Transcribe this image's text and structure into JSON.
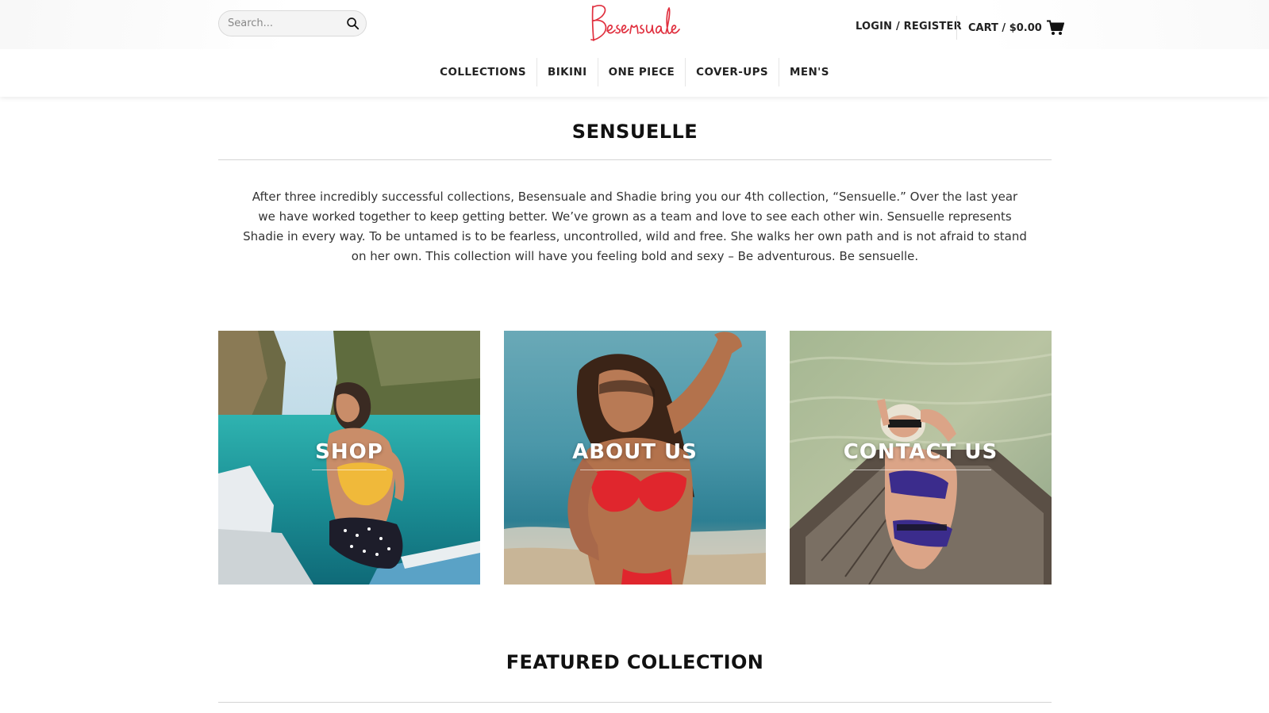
{
  "brand": {
    "logo_text": "Besensuale",
    "accent_color": "#e0303f"
  },
  "header": {
    "search": {
      "placeholder": "Search...",
      "icon": "search-icon"
    },
    "account_label": "LOGIN / REGISTER",
    "cart": {
      "label": "CART / $0.00",
      "icon": "cart-icon"
    }
  },
  "nav": {
    "items": [
      {
        "label": "COLLECTIONS"
      },
      {
        "label": "BIKINI"
      },
      {
        "label": "ONE PIECE"
      },
      {
        "label": "COVER-UPS"
      },
      {
        "label": "MEN'S"
      }
    ]
  },
  "main": {
    "title": "SENSUELLE",
    "intro": "After three incredibly successful collections, Besensuale and Shadie bring you our 4th collection, “Sensuelle.” Over the last year we have worked together to keep getting better. We’ve grown as a team and love to see each other win. Sensuelle represents Shadie in every way. To be untamed is to be fearless, uncontrolled, wild and free. She walks her own path and is not afraid to stand on her own. This collection will have you feeling bold and sexy – Be adventurous. Be sensuelle.",
    "tiles": [
      {
        "label": "SHOP"
      },
      {
        "label": "ABOUT US"
      },
      {
        "label": "CONTACT US"
      }
    ],
    "featured_title": "FEATURED COLLECTION"
  }
}
